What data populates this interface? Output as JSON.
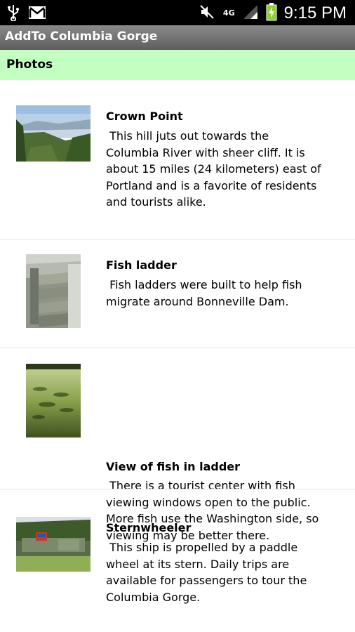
{
  "status_bar": {
    "time": "9:15 PM",
    "network": "4G",
    "icons": [
      "usb-icon",
      "gmail-icon",
      "mute-icon",
      "signal-icon",
      "battery-charging-icon"
    ]
  },
  "app": {
    "title": "AddTo Columbia Gorge"
  },
  "section": {
    "title": "Photos"
  },
  "items": [
    {
      "title": "Crown Point",
      "description": " This hill juts out towards the\nColumbia River with sheer cliff. It is\nabout 15 miles (24 kilometers) east of\nPortland and is a favorite of residents\nand tourists alike."
    },
    {
      "title": "Fish ladder",
      "description": " Fish ladders were built to help fish\nmigrate around Bonneville Dam."
    },
    {
      "title": "View of fish in ladder",
      "description": " There is a tourist center with fish\nviewing windows open to the public.\nMore fish use the Washington side, so\nviewing may be better there."
    },
    {
      "title": "Sternwheeler",
      "description": " This ship is propelled by a paddle\nwheel at its stern. Daily trips are\navailable for passengers to tour the\nColumbia Gorge."
    }
  ],
  "colors": {
    "section_bar": "#c2ffc0",
    "title_bar": "#6f6f6f",
    "status_bar": "#000000"
  }
}
